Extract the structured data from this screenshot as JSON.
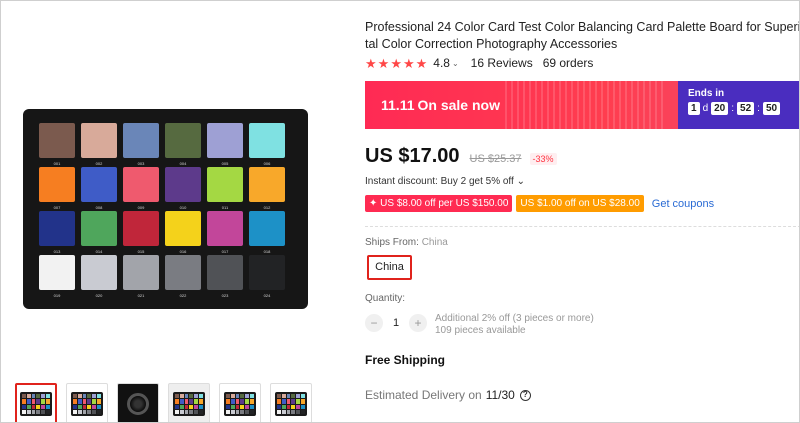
{
  "product": {
    "title_line1": "Professional 24 Color Card Test Color Balancing Card Palette Board for Superior Digi",
    "title_line2": "tal Color Correction Photography Accessories",
    "rating": "4.8",
    "reviews": "16 Reviews",
    "orders": "69 orders"
  },
  "banner": {
    "event": "11.11",
    "label": "On sale now",
    "ends_label": "Ends in",
    "days": "1",
    "days_unit": "d",
    "hours": "20",
    "minutes": "52",
    "seconds": "50",
    "sep": ":"
  },
  "price": {
    "current": "US $17.00",
    "original": "US $25.37",
    "discount": "-33%"
  },
  "promo": {
    "instant_discount": "Instant discount: Buy 2 get 5% off",
    "coupon1": "✦ US $8.00 off per US $150.00",
    "coupon2": "US $1.00 off on US $28.00",
    "get_coupons": "Get coupons"
  },
  "shipping": {
    "ships_from_label": "Ships From:",
    "ships_from_value": "China",
    "country_option": "China",
    "free_shipping": "Free Shipping",
    "estimated_label": "Estimated Delivery on",
    "estimated_date": "11/30"
  },
  "quantity": {
    "label": "Quantity:",
    "value": "1",
    "minus": "−",
    "plus": "+",
    "additional": "Additional 2% off (3 pieces or more)",
    "available": "109 pieces available"
  },
  "color_card": {
    "patches": [
      {
        "num": "001",
        "color": "#7b5a4e"
      },
      {
        "num": "002",
        "color": "#d8aa9a"
      },
      {
        "num": "003",
        "color": "#6a86b8"
      },
      {
        "num": "004",
        "color": "#566a40"
      },
      {
        "num": "005",
        "color": "#9ea0d4"
      },
      {
        "num": "006",
        "color": "#7fe1e2"
      },
      {
        "num": "007",
        "color": "#f67e21"
      },
      {
        "num": "008",
        "color": "#3f5cc7"
      },
      {
        "num": "009",
        "color": "#ef5a6e"
      },
      {
        "num": "010",
        "color": "#5d3a8b"
      },
      {
        "num": "011",
        "color": "#a4d843"
      },
      {
        "num": "012",
        "color": "#f8a82a"
      },
      {
        "num": "013",
        "color": "#22338a"
      },
      {
        "num": "014",
        "color": "#4fa65c"
      },
      {
        "num": "015",
        "color": "#c0263a"
      },
      {
        "num": "016",
        "color": "#f4d21b"
      },
      {
        "num": "017",
        "color": "#c2469a"
      },
      {
        "num": "018",
        "color": "#1d91c7"
      },
      {
        "num": "019",
        "color": "#f2f2f2"
      },
      {
        "num": "020",
        "color": "#c9cbd2"
      },
      {
        "num": "021",
        "color": "#a2a4aa"
      },
      {
        "num": "022",
        "color": "#7a7c82"
      },
      {
        "num": "023",
        "color": "#505256"
      },
      {
        "num": "024",
        "color": "#222325"
      }
    ]
  },
  "thumbnails": [
    "thumbnail-color-card",
    "thumbnail-card-front",
    "thumbnail-lens-photo",
    "thumbnail-card-pieces",
    "thumbnail-card-angle",
    "thumbnail-card-side"
  ]
}
